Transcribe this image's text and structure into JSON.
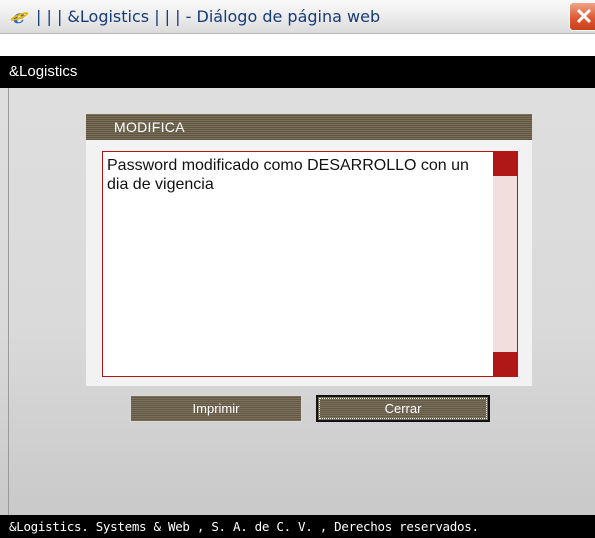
{
  "window": {
    "title": "| | | &Logistics | | | - Diálogo de página web",
    "close_glyph": "✕",
    "browser_icon": "ie-icon"
  },
  "header": {
    "app_name": "&Logistics"
  },
  "panel": {
    "title": "MODIFICA",
    "message": "Password modificado como DESARROLLO con un dia de vigencia"
  },
  "buttons": {
    "print_label": "Imprimir",
    "close_label": "Cerrar"
  },
  "footer": {
    "text": "&Logistics. Systems & Web , S. A. de C. V. , Derechos reservados."
  },
  "colors": {
    "accent_dark": "#5e5543",
    "scroll_red": "#b01818",
    "header_bg": "#000000"
  }
}
